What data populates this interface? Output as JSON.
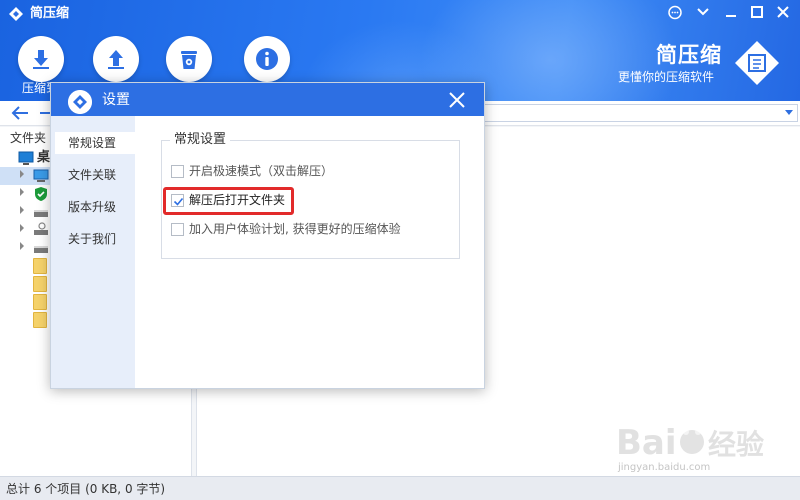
{
  "app": {
    "title": "简压缩",
    "brand_name": "简压缩",
    "brand_slogan": "更懂你的压缩软件",
    "accent_color": "#2d6fe3"
  },
  "toolbar": {
    "compress_label": "压缩到",
    "buttons": [
      "download-icon",
      "upload-icon",
      "trash-icon",
      "info-icon"
    ]
  },
  "tree": {
    "header": "文件夹",
    "desktop_label": "桌"
  },
  "status": {
    "text": "总计 6 个项目 (0 KB, 0 字节)"
  },
  "dialog": {
    "title": "设置",
    "nav": [
      {
        "label": "常规设置"
      },
      {
        "label": "文件关联"
      },
      {
        "label": "版本升级"
      },
      {
        "label": "关于我们"
      }
    ],
    "group_title": "常规设置",
    "options": [
      {
        "label": "开启极速模式（双击解压）",
        "checked": false
      },
      {
        "label": "解压后打开文件夹",
        "checked": true
      },
      {
        "label": "加入用户体验计划, 获得更好的压缩体验",
        "checked": false
      }
    ]
  },
  "watermark": {
    "text": "jingyan.baidu.com"
  }
}
